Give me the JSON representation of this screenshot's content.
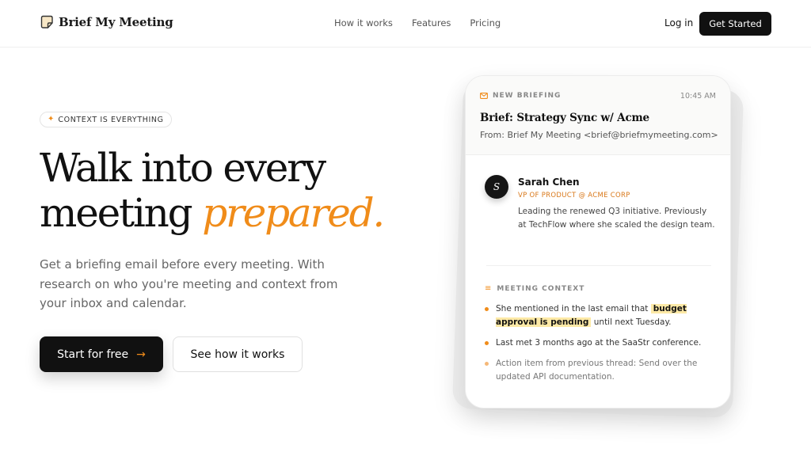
{
  "header": {
    "brand": "Brief My Meeting",
    "nav": [
      "How it works",
      "Features",
      "Pricing"
    ],
    "login_label": "Log in",
    "cta_label": "Get Started"
  },
  "hero": {
    "badge": "CONTEXT IS EVERYTHING",
    "headline_line1": "Walk into every",
    "headline_line2_plain": "meeting ",
    "headline_line2_accent": "prepared.",
    "subtext": "Get a briefing email before every meeting. With research on who you're meeting and context from your inbox and calendar.",
    "primary_button": "Start for free",
    "secondary_button": "See how it works"
  },
  "card": {
    "label": "NEW BRIEFING",
    "time": "10:45 AM",
    "subject": "Brief: Strategy Sync w/ Acme",
    "from": "From: Brief My Meeting <brief@briefmymeeting.com>",
    "person": {
      "initial": "S",
      "name": "Sarah Chen",
      "title": "VP OF PRODUCT @ ACME CORP",
      "bio": "Leading the renewed Q3 initiative. Previously at TechFlow where she scaled the design team."
    },
    "context_label": "MEETING CONTEXT",
    "bullet1_before": "She mentioned in the last email that ",
    "bullet1_highlight": "budget approval is pending",
    "bullet1_after": " until next Tuesday.",
    "bullet2": "Last met 3 months ago at the SaaStr conference.",
    "bullet3": "Action item from previous thread: Send over the updated API documentation."
  },
  "colors": {
    "accent": "#f08c1a",
    "dark": "#111111",
    "highlight": "#fde9a6"
  },
  "icons": {
    "logo": "document-note-icon",
    "badge": "sparkle-icon",
    "button_arrow": "arrow-right-icon",
    "card_label": "mail-icon",
    "context": "list-icon"
  }
}
